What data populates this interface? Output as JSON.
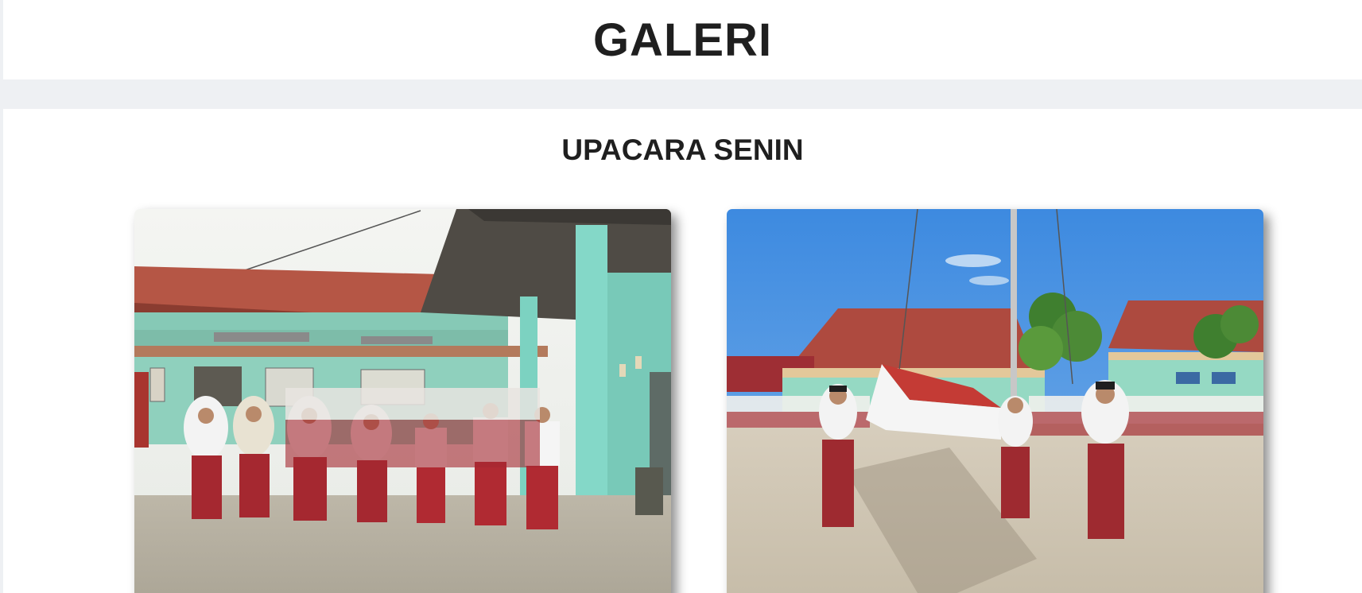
{
  "header": {
    "title": "GALERI"
  },
  "gallery": {
    "section_title": "UPACARA SENIN",
    "photos": [
      {
        "description": "Students in red and white uniforms lined up in front of a mint-green school building"
      },
      {
        "description": "Three students raising the Indonesian red and white flag at a flagpole in the schoolyard"
      }
    ]
  },
  "colors": {
    "page_background": "#eef0f3",
    "card_background": "#ffffff",
    "heading_text": "#1f1f1f"
  }
}
